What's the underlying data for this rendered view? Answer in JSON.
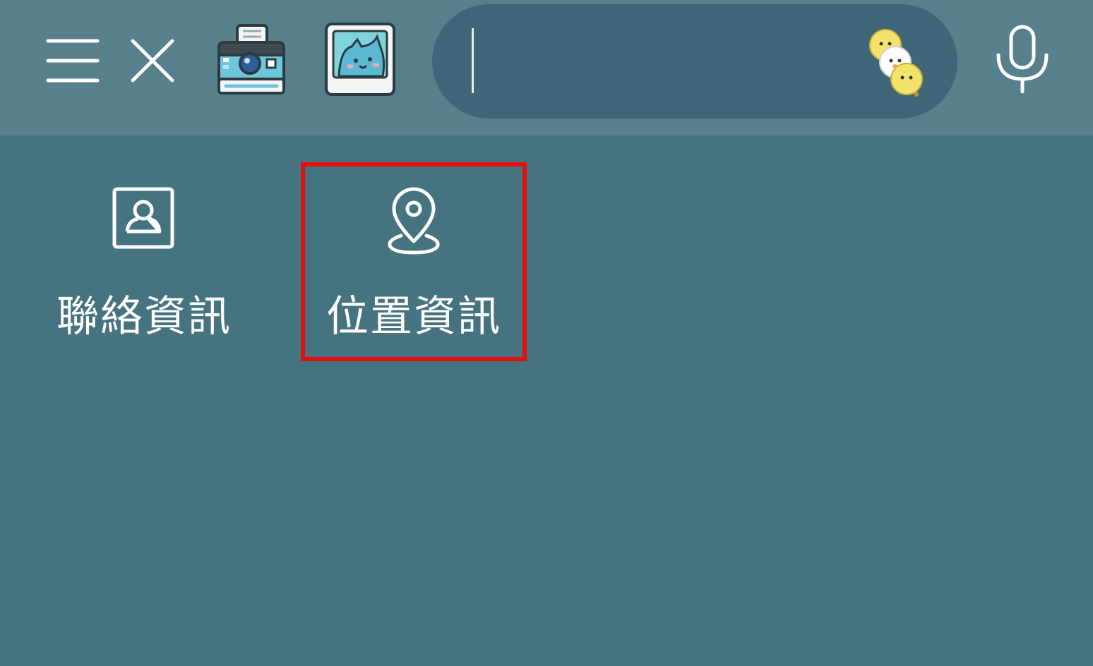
{
  "toolbar": {
    "menu_icon": "hamburger-menu-icon",
    "close_icon": "close-icon",
    "camera_icon": "instant-camera-icon",
    "photo_icon": "photo-card-icon",
    "search": {
      "placeholder": "",
      "value": "",
      "sticker_icon": "dango-sticker-icon"
    },
    "mic_icon": "microphone-icon"
  },
  "attachments": [
    {
      "label": "聯絡資訊",
      "icon": "contact-card-icon",
      "highlighted": false
    },
    {
      "label": "位置資訊",
      "icon": "location-pin-icon",
      "highlighted": true
    }
  ],
  "colors": {
    "background": "#45737f",
    "toolbar": "#56808b",
    "search_bar": "#3f6679",
    "highlight": "#e30f0f",
    "text": "#ffffff"
  }
}
